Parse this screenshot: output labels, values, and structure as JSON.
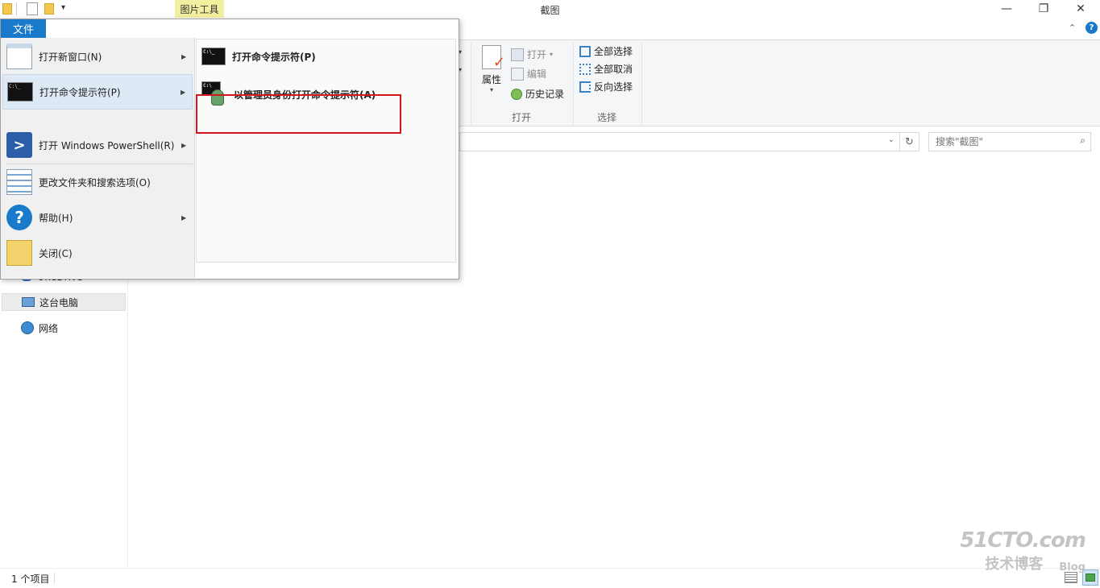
{
  "window": {
    "title": "截图",
    "context_tab": "图片工具"
  },
  "ribbon": {
    "open_group": {
      "properties": "属性",
      "open": "打开",
      "edit": "编辑",
      "history": "历史记录",
      "label": "打开"
    },
    "select_group": {
      "select_all": "全部选择",
      "select_none": "全部取消",
      "invert": "反向选择",
      "label": "选择"
    }
  },
  "search": {
    "placeholder": "搜索\"截图\""
  },
  "nav": {
    "onedrive": "OneDrive",
    "this_pc": "这台电脑",
    "network": "网络"
  },
  "status": {
    "count": "1 个项目"
  },
  "file_menu": {
    "tab": "文件",
    "items": [
      {
        "label": "打开新窗口(N)"
      },
      {
        "label": "打开命令提示符(P)"
      },
      {
        "label": "打开 Windows PowerShell(R)"
      },
      {
        "label": "更改文件夹和搜索选项(O)"
      },
      {
        "label": "帮助(H)"
      },
      {
        "label": "关闭(C)"
      }
    ],
    "submenu": [
      {
        "label": "打开命令提示符(P)"
      },
      {
        "label": "以管理员身份打开命令提示符(A)"
      }
    ]
  },
  "watermark": {
    "line1": "51CTO.com",
    "line2": "技术博客",
    "line3": "Blog"
  },
  "colors": {
    "accent": "#1979ca",
    "highlight": "#d0181e",
    "context_tab": "#f3efa0"
  }
}
